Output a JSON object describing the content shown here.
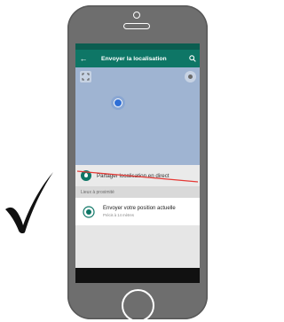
{
  "appbar": {
    "title": "Envoyer la localisation",
    "back_icon": "arrow-left-icon",
    "search_icon": "search-icon"
  },
  "map": {
    "expand_icon": "expand-icon",
    "gps_icon": "gps-icon",
    "location_marker": "my-location-dot"
  },
  "live_location": {
    "label": "Partager localisation en direct",
    "icon": "live-location-icon",
    "struck_out": true,
    "strike_color": "#e53935"
  },
  "section": {
    "header": "Lieux à proximité"
  },
  "current_position": {
    "title": "Envoyer votre position actuelle",
    "subtitle": "Précis à 14 mètres",
    "icon": "target-icon"
  },
  "annotation": {
    "checkmark_icon": "checkmark-icon"
  },
  "colors": {
    "accent": "#0e7666",
    "status_bar": "#0b5d50",
    "phone_body": "#6e6e6e",
    "map": "#9fb4d2"
  }
}
